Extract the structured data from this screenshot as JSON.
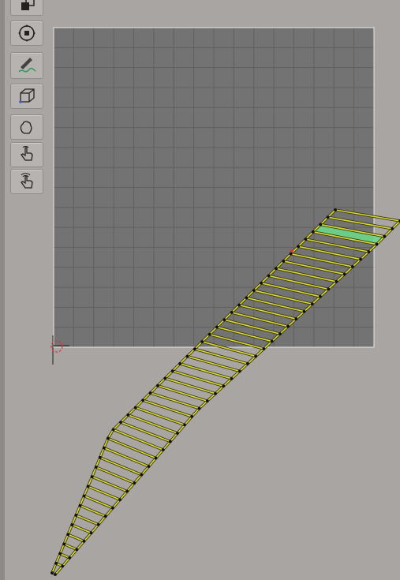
{
  "toolbar": {
    "tools": [
      {
        "name": "view-toggle-button",
        "icon": "view-toggle-icon"
      },
      {
        "name": "navigation-button",
        "icon": "navigation-gizmo-icon"
      },
      {
        "name": "draw-curve-button",
        "icon": "draw-curve-icon"
      },
      {
        "name": "edit-mesh-button",
        "icon": "cube-edit-icon"
      },
      {
        "name": "grab-hand-button",
        "icon": "grab-hand-icon"
      },
      {
        "name": "tap-gesture-button",
        "icon": "tap-hand-icon"
      },
      {
        "name": "double-tap-gesture-button",
        "icon": "double-tap-hand-icon"
      }
    ]
  },
  "viewport": {
    "grid_divisions": 16,
    "colors": {
      "grid_fill": "#747373",
      "grid_line": "#606060",
      "grid_border": "#e8e8e8",
      "edge_outer": "#3a3a10",
      "edge_inner": "#d9d93a",
      "selected_face": "#6bd78c",
      "vertex": "#111111",
      "origin_marker": "#e03030"
    }
  }
}
